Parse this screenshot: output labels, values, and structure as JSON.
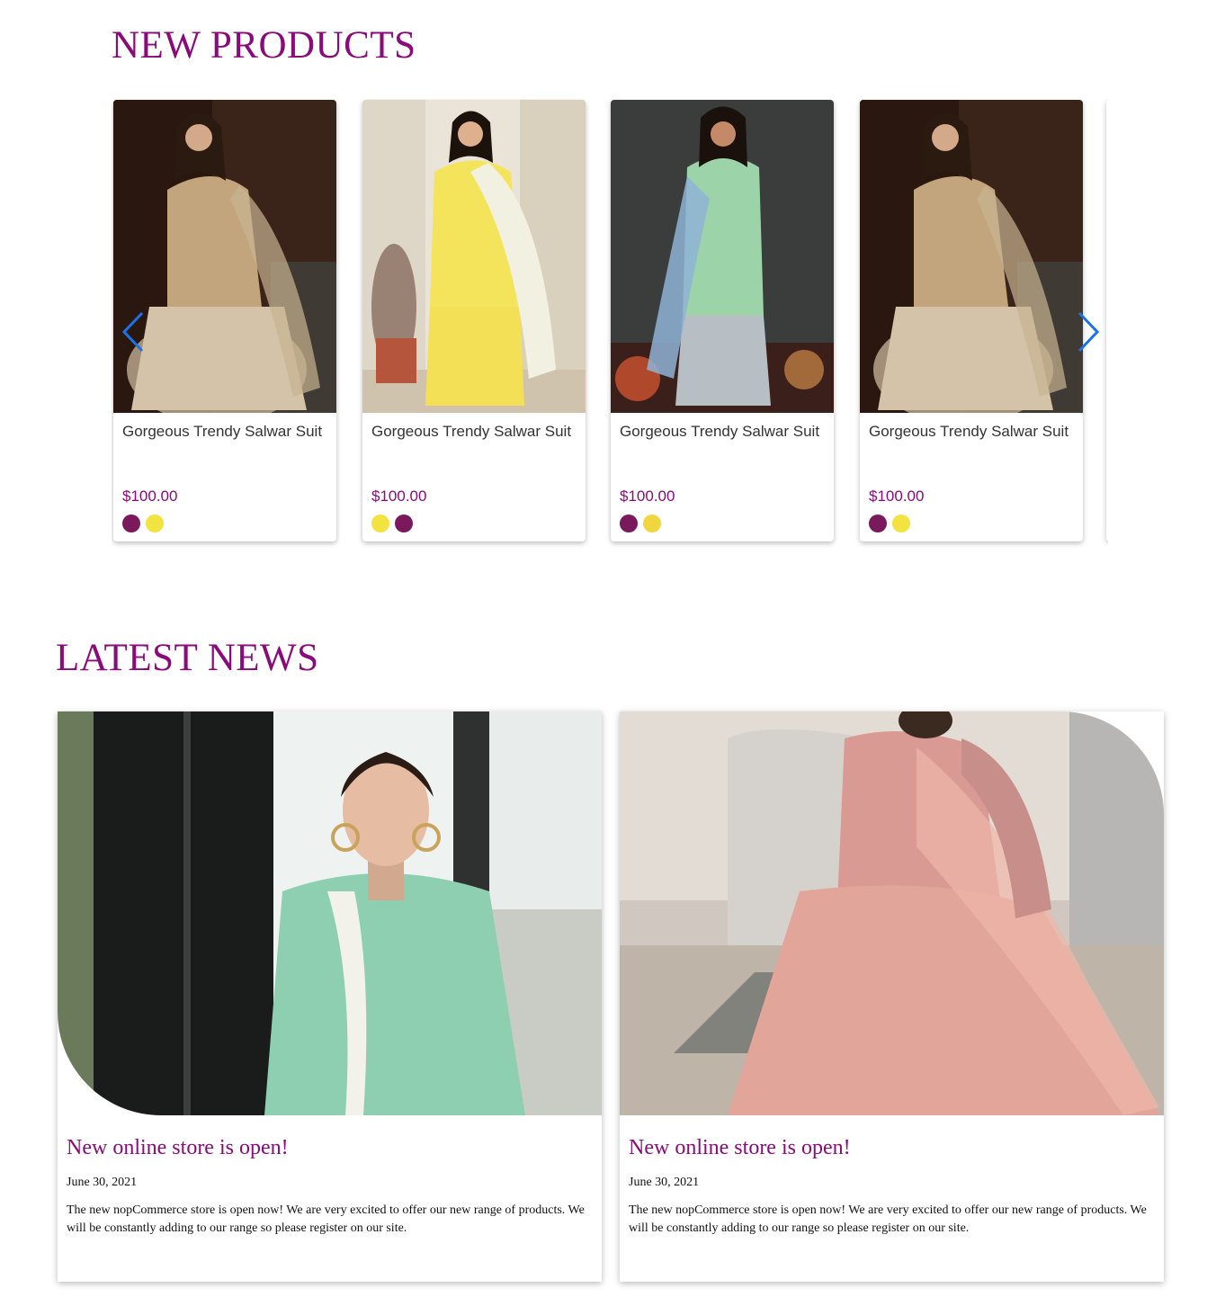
{
  "new_products": {
    "title": "NEW PRODUCTS",
    "products": [
      {
        "name": "Gorgeous Trendy Salwar Suit",
        "price": "$100.00",
        "swatches": [
          "#7a1a5c",
          "#f2e341"
        ]
      },
      {
        "name": "Gorgeous Trendy Salwar Suit",
        "price": "$100.00",
        "swatches": [
          "#f2e341",
          "#7a1a5c"
        ]
      },
      {
        "name": "Gorgeous Trendy Salwar Suit",
        "price": "$100.00",
        "swatches": [
          "#7a1a5c",
          "#f2d640"
        ]
      },
      {
        "name": "Gorgeous Trendy Salwar Suit",
        "price": "$100.00",
        "swatches": [
          "#7a1a5c",
          "#f2e341"
        ]
      }
    ],
    "arrows": {
      "prev_icon": "chevron-left-icon",
      "next_icon": "chevron-right-icon",
      "color": "#1a73e8"
    }
  },
  "latest_news": {
    "title": "LATEST NEWS",
    "items": [
      {
        "title": "New online store is open!",
        "date": "June 30, 2021",
        "body": "The new nopCommerce store is open now! We are very excited to offer our new range of products. We will be constantly adding to our range so please register on our site."
      },
      {
        "title": "New online store is open!",
        "date": "June 30, 2021",
        "body": "The new nopCommerce store is open now! We are very excited to offer our new range of products. We will be constantly adding to our range so please register on our site."
      }
    ]
  },
  "colors": {
    "accent": "#8a0a7b",
    "arrow": "#1a73e8"
  }
}
